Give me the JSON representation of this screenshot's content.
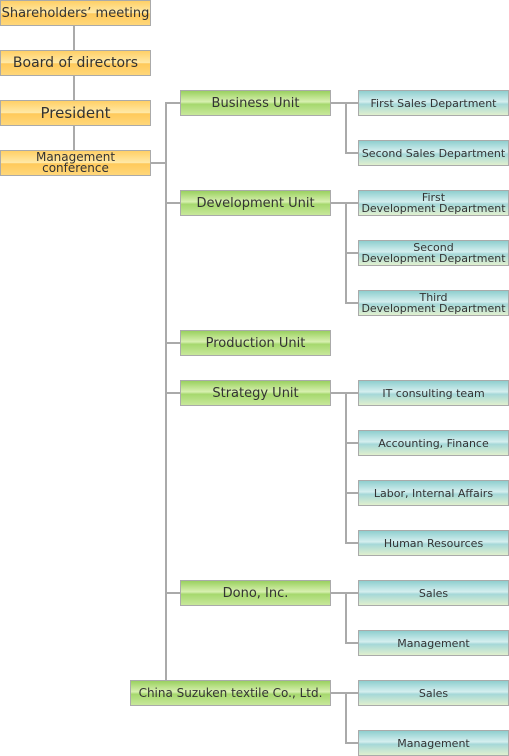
{
  "top": [
    "Shareholders’ meeting",
    "Board of directors",
    "President",
    "Management conference"
  ],
  "units": [
    {
      "label": "Business Unit",
      "children": [
        "First Sales Department",
        "Second Sales Department"
      ]
    },
    {
      "label": "Development Unit",
      "children": [
        [
          "First",
          "Development Department"
        ],
        [
          "Second",
          "Development Department"
        ],
        [
          "Third",
          "Development Department"
        ]
      ]
    },
    {
      "label": "Production Unit",
      "children": []
    },
    {
      "label": "Strategy Unit",
      "children": [
        "IT consulting team",
        "Accounting, Finance",
        "Labor, Internal Affairs",
        "Human Resources"
      ]
    },
    {
      "label": "Dono, Inc.",
      "children": [
        "Sales",
        "Management"
      ]
    },
    {
      "label": "China Suzuken textile Co., Ltd.",
      "children": [
        "Sales",
        "Management"
      ]
    }
  ],
  "colors": {
    "top": "#ffd066",
    "unit": "#9ad160",
    "department": "#8fcfcf",
    "line": "#aaaaaa"
  }
}
